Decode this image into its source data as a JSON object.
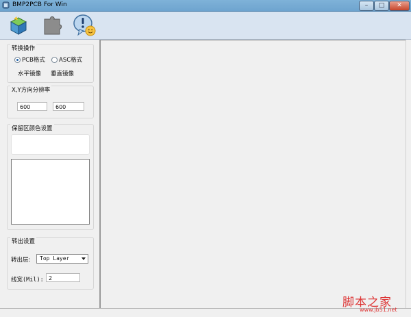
{
  "window": {
    "title": "BMP2PCB For Win",
    "controls": {
      "minimize": "–",
      "maximize": "□",
      "close": "✕"
    }
  },
  "toolbar": {
    "buttons": [
      {
        "icon": "convert-cube-icon"
      },
      {
        "icon": "puzzle-shape-icon"
      },
      {
        "icon": "help-smiley-icon"
      }
    ]
  },
  "conversion": {
    "title": "转换操作",
    "format_options": [
      {
        "label": "PCB格式",
        "checked": true
      },
      {
        "label": "ASC格式",
        "checked": false
      }
    ],
    "mirror_horizontal": "水平镜像",
    "mirror_vertical": "垂直镜像"
  },
  "resolution": {
    "title": "X,Y方向分辨率",
    "x_value": "600",
    "y_value": "600"
  },
  "reserve_color": {
    "title": "保留区颜色设置"
  },
  "output": {
    "title": "转出设置",
    "layer_label": "转出层:",
    "layer_value": "Top Layer",
    "width_label": "线宽(Mil):",
    "width_value": "2"
  },
  "watermark": {
    "main": "脚本之家",
    "sub": "www.jb51.net"
  }
}
